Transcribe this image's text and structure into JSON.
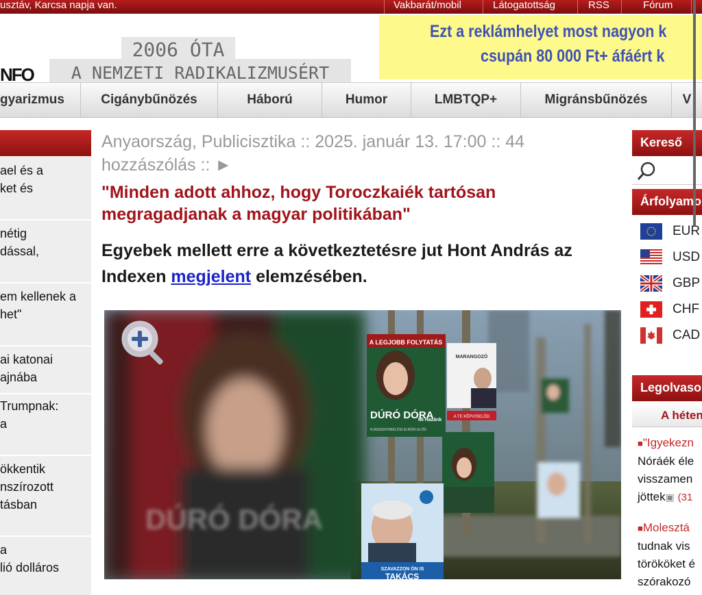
{
  "topbar": {
    "greeting": "usztáv, Karcsa napja van.",
    "links": [
      "Vakbarát/mobil",
      "Látogatottság",
      "RSS",
      "Fórum"
    ]
  },
  "header": {
    "logo_text": "NFO",
    "stamp_line1": "2006 ÓTA",
    "stamp_line2": "A NEMZETI RADIKALIZMUSÉRT",
    "ad_line1": "Ezt a reklámhelyet most nagyon k",
    "ad_line2": "csupán 80 000 Ft+ áfáért k"
  },
  "nav": {
    "items": [
      "gyarizmus",
      "Cigánybűnözés",
      "Háború",
      "Humor",
      "LMBTQP+",
      "Migránsbűnözés",
      "V"
    ]
  },
  "left_stories": [
    [
      "ael és a",
      "ket és"
    ],
    [
      "nétig",
      "dással,"
    ],
    [
      "em kellenek a",
      "het\""
    ],
    [
      "ai katonai",
      "ajnába"
    ],
    [
      " Trumpnak:",
      "a"
    ],
    [
      "ökkentik",
      "nszírozott",
      "tásban"
    ],
    [
      "a",
      "lió dolláros"
    ]
  ],
  "article": {
    "meta": "Anyaország, Publicisztika :: 2025. január 13. 17:00 :: 44 hozzászólás :: ►",
    "title": "\"Minden adott ahhoz, hogy Toroczkaiék tartósan megragadjanak a magyar politikában\"",
    "lead_before": "Egyebek mellett erre a következtetésre jut Hont András az Indexen ",
    "lead_link": "megjelent",
    "lead_after": " elemzésében."
  },
  "photo": {
    "zoom_icon": "zoom-in-icon",
    "poster_headline": "A LEGJOBB FOLYTATÁS",
    "poster_name": "DÚRÓ DÓRA",
    "poster_subtitle": "KUNSZENTMIKLÓSI ELNÖKI ELŐD",
    "poster_party": "Mi Hazánk",
    "poster_right_name": "MARANGOZÓ",
    "poster_right_label": "A TE KÉPVISELŐD",
    "poster_bottom_slogan": "SZAVAZZON ÖN IS",
    "poster_bottom_name": "TAKÁCS",
    "blurred_name": "DÚRÓ DÓRA"
  },
  "right": {
    "search_header": "Kereső",
    "rates_header": "Árfolyamo",
    "rates": [
      {
        "code": "EUR",
        "flag": "eu-flag"
      },
      {
        "code": "USD",
        "flag": "us-flag"
      },
      {
        "code": "GBP",
        "flag": "uk-flag"
      },
      {
        "code": "CHF",
        "flag": "ch-flag"
      },
      {
        "code": "CAD",
        "flag": "ca-flag"
      }
    ],
    "popular_header": "Legolvaso",
    "popular_tab": "A héten",
    "popular": [
      {
        "lines": [
          "\"Igyekezn",
          "Nóráék éle",
          "visszamen",
          "jöttek"
        ],
        "count": "(31"
      },
      {
        "lines": [
          "Molesztá",
          "tudnak vis",
          "törököket é",
          "szórakozó"
        ]
      }
    ]
  },
  "colors": {
    "brand_red": "#a0141b",
    "link_blue": "#1a23c8",
    "ad_yellow": "#fdf98a",
    "ad_text": "#3f51b5"
  }
}
